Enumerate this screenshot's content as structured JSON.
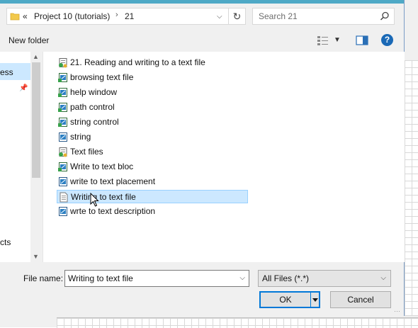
{
  "address": {
    "overflow": "«",
    "crumbs": [
      "Project 10 (tutorials)",
      "21"
    ],
    "separator": "›"
  },
  "search": {
    "placeholder": "Search 21"
  },
  "toolbar": {
    "new_folder": "New folder"
  },
  "nav": {
    "items": [
      {
        "label": "ess",
        "selected": true,
        "pinned": true
      },
      {
        "label": "cts"
      }
    ]
  },
  "files": [
    {
      "name": "21. Reading and writing to a text file",
      "icon": "project-icon"
    },
    {
      "name": "browsing text file",
      "icon": "vi-icon"
    },
    {
      "name": "help window",
      "icon": "vi-icon"
    },
    {
      "name": "path control",
      "icon": "vi-icon"
    },
    {
      "name": "string control",
      "icon": "vi-icon"
    },
    {
      "name": "string",
      "icon": "vi-blue-icon"
    },
    {
      "name": "Text files",
      "icon": "project-icon"
    },
    {
      "name": "Write to text bloc",
      "icon": "vi-icon"
    },
    {
      "name": "write to text placement",
      "icon": "vi-blue-icon"
    },
    {
      "name": "Writing to text file",
      "icon": "text-file-icon",
      "selected": true
    },
    {
      "name": "wrte to text description",
      "icon": "vi-blue-icon"
    }
  ],
  "footer": {
    "file_name_label": "File name:",
    "file_name_value": "Writing to text file",
    "file_type": "All Files (*.*)",
    "ok": "OK",
    "cancel": "Cancel"
  },
  "colors": {
    "accent": "#0078d7",
    "selection": "#cce8ff",
    "title_strip": "#4ea9c6"
  }
}
